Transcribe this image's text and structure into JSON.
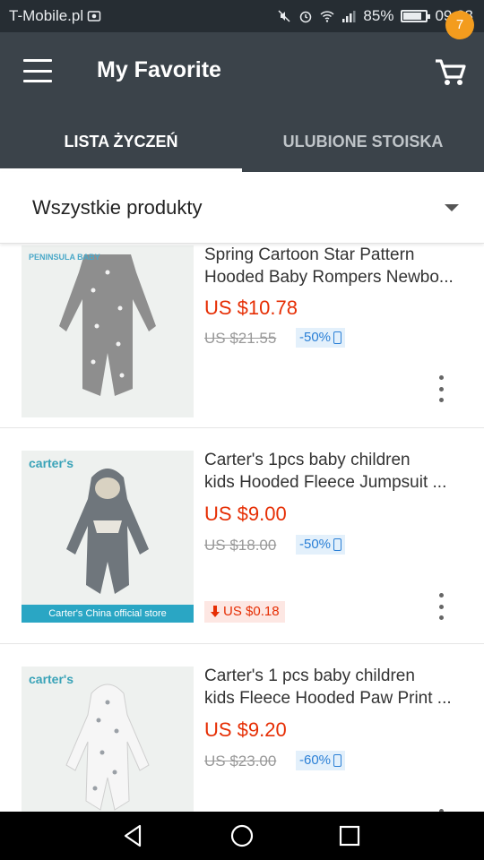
{
  "status_bar": {
    "carrier": "T-Mobile.pl",
    "battery": "85%",
    "battery_level": 0.85,
    "time": "09:23"
  },
  "app_bar": {
    "title": "My Favorite",
    "cart_count": "7",
    "tabs": [
      {
        "label": "LISTA ŻYCZEŃ",
        "active": true
      },
      {
        "label": "ULUBIONE STOISKA",
        "active": false
      }
    ]
  },
  "filter": {
    "label": "Wszystkie produkty"
  },
  "products": [
    {
      "brand": "PENINSULA BABY",
      "title_line1": "Spring Cartoon Star Pattern",
      "title_line2": "Hooded Baby Rompers Newbo...",
      "price": "US $10.78",
      "original_price": "US $21.55",
      "discount": "-50%"
    },
    {
      "brand": "carter's",
      "title_line1": "Carter's 1pcs baby children",
      "title_line2": "kids Hooded Fleece Jumpsuit ...",
      "price": "US $9.00",
      "original_price": "US $18.00",
      "discount": "-50%",
      "store_band": "Carter's China official store",
      "price_drop": "US $0.18"
    },
    {
      "brand": "carter's",
      "title_line1": "Carter's 1 pcs  baby children",
      "title_line2": "kids Fleece Hooded Paw Print ...",
      "price": "US $9.20",
      "original_price": "US $23.00",
      "discount": "-60%"
    }
  ],
  "colors": {
    "app_bar": "#3b434a",
    "status_bar": "#262d33",
    "price": "#e62e04",
    "badge": "#f39c1e",
    "discount_text": "#2a7fd6"
  },
  "icons": [
    "menu-icon",
    "cart-icon",
    "dropdown-caret-icon",
    "more-vert-icon",
    "mobile-phone-icon",
    "arrow-down-icon",
    "nav-back-icon",
    "nav-home-icon",
    "nav-recents-icon"
  ]
}
